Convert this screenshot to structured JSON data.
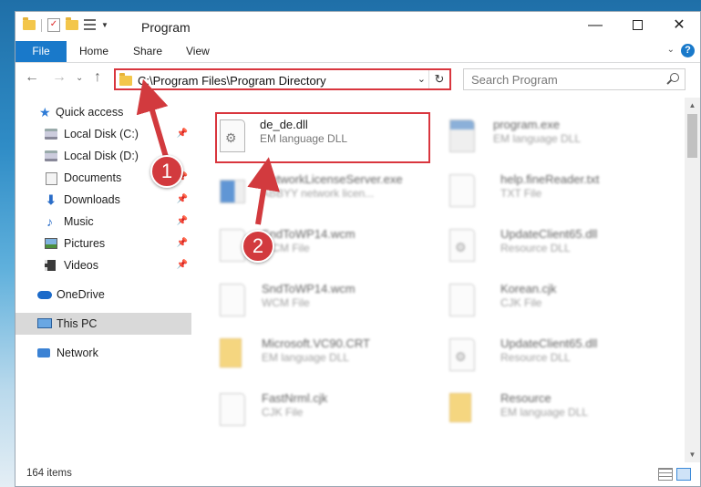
{
  "window": {
    "title": "Program",
    "controls": {
      "minimize": "—",
      "maximize": "",
      "close": "✕"
    }
  },
  "ribbon": {
    "file_tab": "File",
    "tabs": [
      "Home",
      "Share",
      "View"
    ],
    "help": "?"
  },
  "navbar": {
    "address": "C:\\Program Files\\Program Directory",
    "search_placeholder": "Search Program"
  },
  "sidebar": {
    "items": [
      {
        "label": "Quick access",
        "icon": "star-icon"
      },
      {
        "label": "Local Disk (C:)",
        "icon": "disk-icon",
        "pinned": true
      },
      {
        "label": "Local Disk (D:)",
        "icon": "disk-icon",
        "pinned": true
      },
      {
        "label": "Documents",
        "icon": "documents-icon",
        "pinned": true
      },
      {
        "label": "Downloads",
        "icon": "downloads-icon",
        "pinned": true
      },
      {
        "label": "Music",
        "icon": "music-icon",
        "pinned": true
      },
      {
        "label": "Pictures",
        "icon": "pictures-icon",
        "pinned": true
      },
      {
        "label": "Videos",
        "icon": "videos-icon",
        "pinned": true
      },
      {
        "label": "OneDrive",
        "icon": "onedrive-icon"
      },
      {
        "label": "This PC",
        "icon": "this-pc-icon",
        "selected": true
      },
      {
        "label": "Network",
        "icon": "network-icon"
      }
    ]
  },
  "files": {
    "highlighted": {
      "name": "de_de.dll",
      "type": "EM language DLL"
    },
    "others": [
      {
        "name": "program.exe",
        "type": "EM language DLL"
      },
      {
        "name": "NetworkLicenseServer.exe",
        "type": "ABBYY network licen..."
      },
      {
        "name": "help.fineReader.txt",
        "type": "TXT File"
      },
      {
        "name": "SndToWP14.wcm",
        "type": "WCM File"
      },
      {
        "name": "UpdateClient65.dll",
        "type": "Resource DLL"
      },
      {
        "name": "SndToWP14.wcm",
        "type": "WCM File"
      },
      {
        "name": "Korean.cjk",
        "type": "CJK File"
      },
      {
        "name": "Microsoft.VC90.CRT",
        "type": "EM language DLL"
      },
      {
        "name": "UpdateClient65.dll",
        "type": "Resource DLL"
      },
      {
        "name": "FastNrml.cjk",
        "type": "CJK File"
      },
      {
        "name": "Resource",
        "type": "EM language DLL"
      }
    ]
  },
  "status": {
    "item_count": "164 items"
  },
  "annotations": {
    "step1": "1",
    "step2": "2",
    "color": "#d23a3e"
  }
}
